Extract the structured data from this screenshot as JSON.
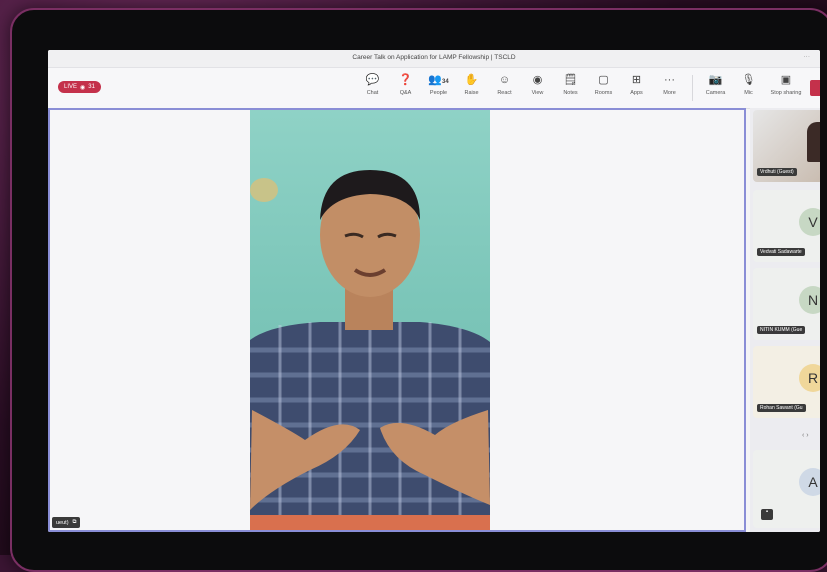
{
  "window": {
    "title": "Career Talk on Application for LAMP Fellowship | TSCLD",
    "dots": "···"
  },
  "live_badge": {
    "label": "LIVE",
    "viewers": "31"
  },
  "toolbar": [
    {
      "label": "Chat",
      "icon": "chat-icon",
      "glyph": "💬"
    },
    {
      "label": "Q&A",
      "icon": "qa-icon",
      "glyph": "❓"
    },
    {
      "label": "People",
      "icon": "people-icon",
      "glyph": "👥",
      "badge": "34"
    },
    {
      "label": "Raise",
      "icon": "raise-hand-icon",
      "glyph": "✋"
    },
    {
      "label": "React",
      "icon": "react-icon",
      "glyph": "☺"
    },
    {
      "label": "View",
      "icon": "view-icon",
      "glyph": "◉"
    },
    {
      "label": "Notes",
      "icon": "notes-icon",
      "glyph": "🗒"
    },
    {
      "label": "Rooms",
      "icon": "rooms-icon",
      "glyph": "▢"
    },
    {
      "label": "Apps",
      "icon": "apps-icon",
      "glyph": "⊞"
    },
    {
      "label": "More",
      "icon": "more-icon",
      "glyph": "···"
    }
  ],
  "controls": [
    {
      "label": "Camera",
      "icon": "camera-icon",
      "glyph": "📷"
    },
    {
      "label": "Mic",
      "icon": "mic-icon",
      "glyph": "🎙"
    },
    {
      "label": "Stop sharing",
      "icon": "stop-sharing-icon",
      "glyph": "▣"
    }
  ],
  "self_view": {
    "label": "ueut)",
    "icon": "share-icon"
  },
  "participants": [
    {
      "name": "Vrdhuti (Guest)",
      "initial": ""
    },
    {
      "name": "Vedvati Sadawarte",
      "initial": "V"
    },
    {
      "name": "NITIN KUMM (Gue",
      "initial": "N"
    },
    {
      "name": "Rohan Sawant (Gu",
      "initial": "R"
    },
    {
      "name": "",
      "initial": "A"
    }
  ],
  "pager": "‹   ›",
  "colors": {
    "accent": "#c4314b",
    "stage_border": "#8a8ed6",
    "frame": "#7a2f63"
  }
}
